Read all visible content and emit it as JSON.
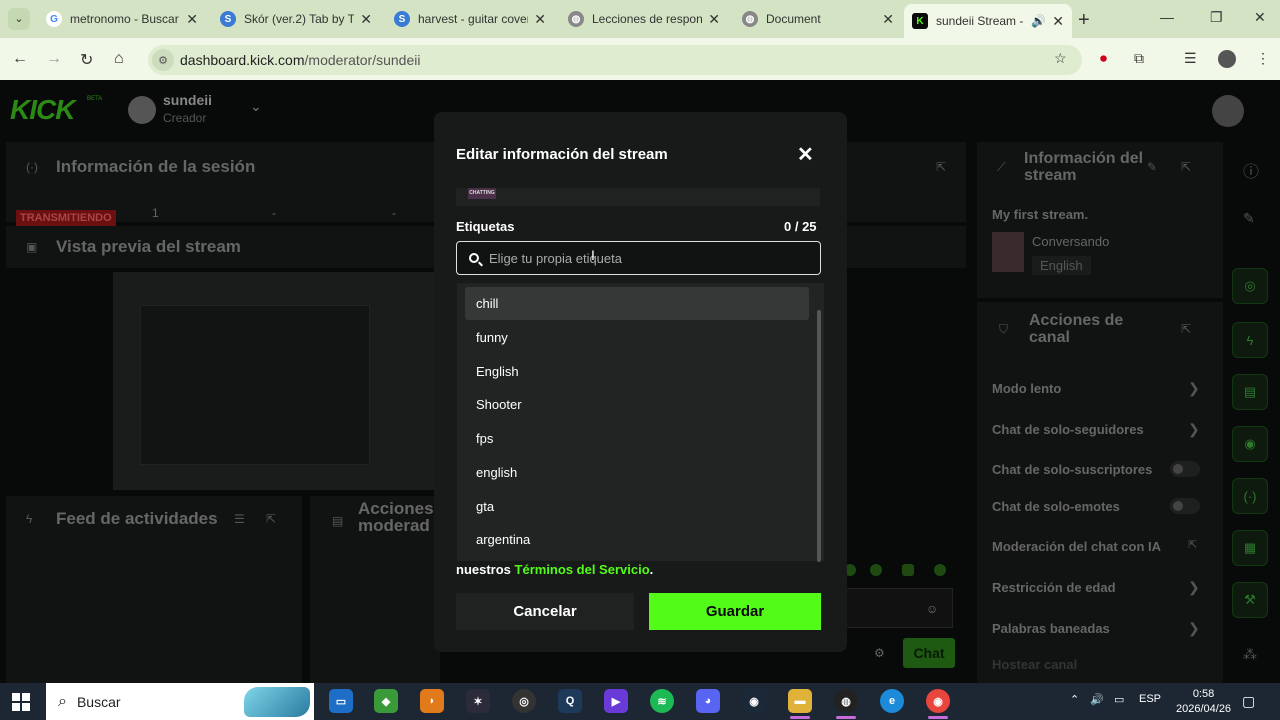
{
  "browser": {
    "tabs": [
      {
        "title": "metronomo - Buscar",
        "icon": "google-icon",
        "color": "#4285f4"
      },
      {
        "title": "Skór (ver.2) Tab by Th",
        "icon": "songsterr-icon",
        "color": "#3a7bd5"
      },
      {
        "title": "harvest - guitar cover",
        "icon": "songsterr-icon",
        "color": "#3a7bd5"
      },
      {
        "title": "Lecciones de respons",
        "icon": "globe-icon",
        "color": "#777777"
      },
      {
        "title": "Document",
        "icon": "globe-icon",
        "color": "#777777"
      },
      {
        "title": "sundeii Stream -",
        "icon": "kick-icon",
        "color": "#53fc18"
      }
    ],
    "url_host": "dashboard.kick.com",
    "url_path": "/moderator/sundeii"
  },
  "dashboard": {
    "logo": "KICK",
    "logo_badge": "BETA",
    "user_name": "sundeii",
    "user_role": "Creador",
    "session_title": "Información de la sesión",
    "live_badge": "TRANSMITIENDO",
    "session_stat": "1",
    "session_dash": "-",
    "preview_title": "Vista previa del stream",
    "feed_title": "Feed de actividades",
    "mod_actions_title": "Acciones moderad",
    "stream_info_title": "Información del stream",
    "stream_name": "My first stream.",
    "stream_category": "Conversando",
    "stream_language": "English",
    "channel_actions_title": "Acciones de canal",
    "actions": [
      {
        "label": "Modo lento",
        "kind": "chevron"
      },
      {
        "label": "Chat de solo-seguidores",
        "kind": "chevron"
      },
      {
        "label": "Chat de solo-suscriptores",
        "kind": "toggle"
      },
      {
        "label": "Chat de solo-emotes",
        "kind": "toggle"
      },
      {
        "label": "Moderación del chat con IA",
        "kind": "external"
      },
      {
        "label": "Restricción de edad",
        "kind": "chevron"
      },
      {
        "label": "Palabras baneadas",
        "kind": "chevron"
      },
      {
        "label": "Hostear canal",
        "kind": "none"
      }
    ],
    "chat_button": "Chat"
  },
  "modal": {
    "title": "Editar información del stream",
    "thumb_text": "CHATTING",
    "tags_label": "Etiquetas",
    "tags_count": "0 / 25",
    "search_placeholder": "Elige tu propia etiqueta",
    "options": [
      "chill",
      "funny",
      "English",
      "Shooter",
      "fps",
      "english",
      "gta",
      "argentina"
    ],
    "highlighted_option": "chill",
    "terms_prefix": "nuestros",
    "terms_link": "Términos del Servicio",
    "terms_suffix": ".",
    "cancel_label": "Cancelar",
    "save_label": "Guardar",
    "accent_color": "#53fc18"
  },
  "taskbar": {
    "search_label": "Buscar",
    "lang": "ESP",
    "time": "0:58",
    "date": "2026/04/26"
  }
}
